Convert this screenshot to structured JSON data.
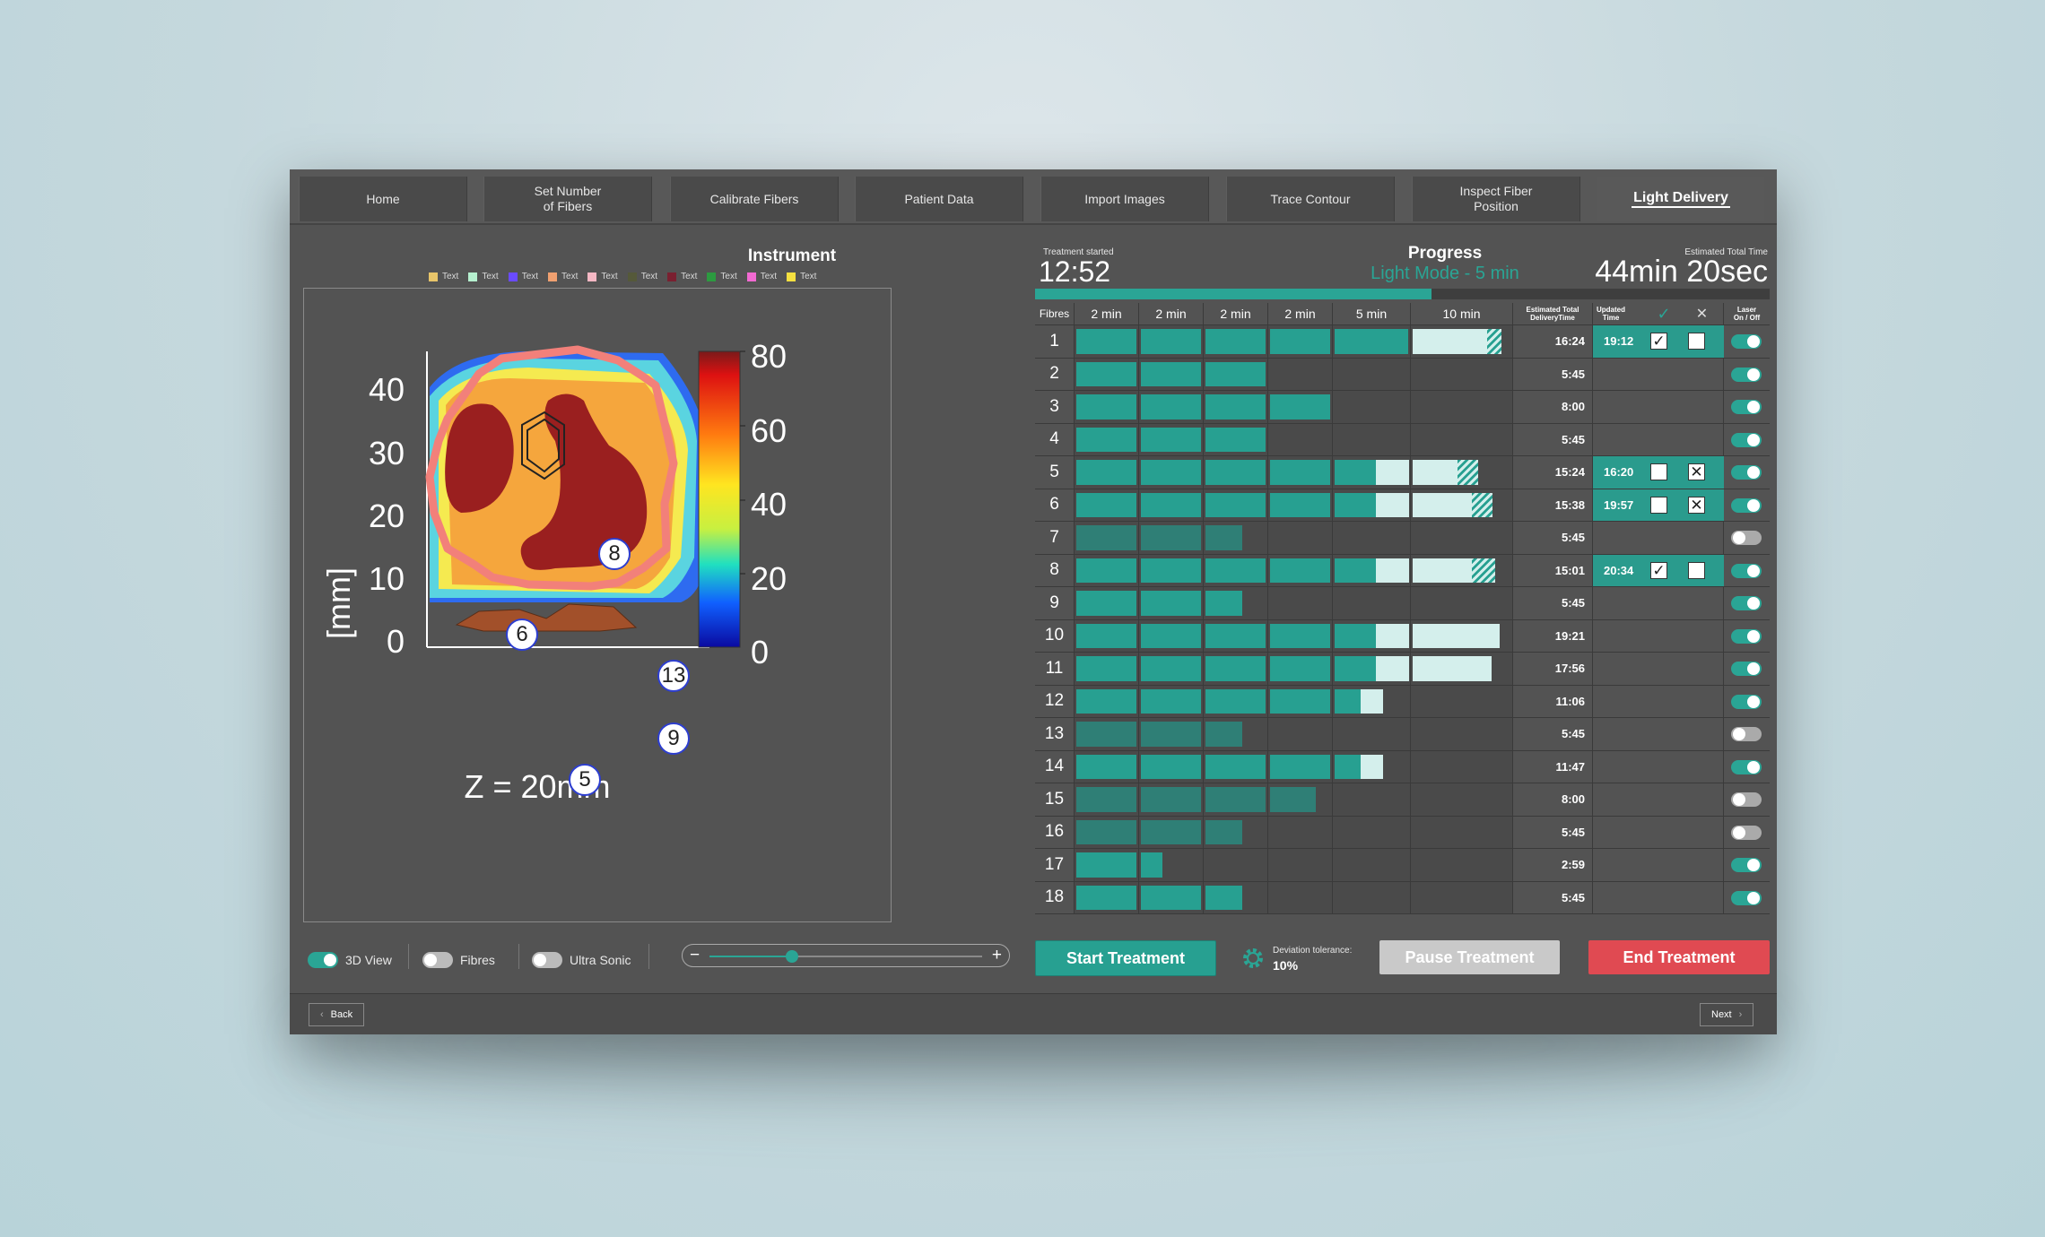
{
  "nav": {
    "tabs": [
      {
        "label": "Home"
      },
      {
        "label": "Set Number\nof Fibers"
      },
      {
        "label": "Calibrate Fibers"
      },
      {
        "label": "Patient Data"
      },
      {
        "label": "Import Images"
      },
      {
        "label": "Trace Contour"
      },
      {
        "label": "Inspect Fiber\nPosition"
      },
      {
        "label": "Light Delivery"
      }
    ],
    "active": "Light Delivery"
  },
  "instrument": {
    "title": "Instrument",
    "legend": [
      {
        "label": "Text",
        "color": "#e8c56a"
      },
      {
        "label": "Text",
        "color": "#b6f0cf"
      },
      {
        "label": "Text",
        "color": "#6a4bff"
      },
      {
        "label": "Text",
        "color": "#f0a070"
      },
      {
        "label": "Text",
        "color": "#f5b8c4"
      },
      {
        "label": "Text",
        "color": "#55593a"
      },
      {
        "label": "Text",
        "color": "#7a2030"
      },
      {
        "label": "Text",
        "color": "#2c9a40"
      },
      {
        "label": "Text",
        "color": "#f26ad2"
      },
      {
        "label": "Text",
        "color": "#f5e040"
      }
    ]
  },
  "plot": {
    "ylabel": "[mm]",
    "yticks": [
      "40",
      "30",
      "20",
      "10",
      "0"
    ],
    "colorbar_ticks": [
      "80",
      "60",
      "40",
      "20",
      "0"
    ],
    "caption": "Z = 20mm",
    "fibre_markers": [
      "6",
      "8",
      "13",
      "9",
      "5"
    ]
  },
  "controls": {
    "view3d": {
      "label": "3D View",
      "on": true
    },
    "fibres": {
      "label": "Fibres",
      "on": false
    },
    "ultrasonic": {
      "label": "Ultra Sonic",
      "on": false
    },
    "zoom": {
      "minus": "−",
      "plus": "+",
      "value": 0.3
    }
  },
  "status": {
    "started_label": "Treatment started",
    "started_time": "12:52",
    "progress_title": "Progress",
    "mode": "Light Mode - 5 min",
    "est_label": "Estimated Total Time",
    "est_value": "44min 20sec",
    "progress": 0.54
  },
  "table": {
    "headers": {
      "fibres": "Fibres",
      "steps": [
        "2 min",
        "2 min",
        "2 min",
        "2 min",
        "5 min",
        "10 min"
      ],
      "est": "Estimated Total\nDeliveryTime",
      "updated": "Updated\nTime",
      "check": "✓",
      "cross": "✕",
      "laser": "Laser\nOn / Off"
    },
    "rows": [
      {
        "n": "1",
        "est": "16:24",
        "upd": "19:12",
        "chk": "✓",
        "x": "",
        "laser": true
      },
      {
        "n": "2",
        "est": "5:45",
        "laser": true
      },
      {
        "n": "3",
        "est": "8:00",
        "laser": true
      },
      {
        "n": "4",
        "est": "5:45",
        "laser": true
      },
      {
        "n": "5",
        "est": "15:24",
        "upd": "16:20",
        "chk": "",
        "x": "✕",
        "laser": true
      },
      {
        "n": "6",
        "est": "15:38",
        "upd": "19:57",
        "chk": "",
        "x": "✕",
        "laser": true
      },
      {
        "n": "7",
        "est": "5:45",
        "laser": false
      },
      {
        "n": "8",
        "est": "15:01",
        "upd": "20:34",
        "chk": "✓",
        "x": "",
        "laser": true
      },
      {
        "n": "9",
        "est": "5:45",
        "laser": true
      },
      {
        "n": "10",
        "est": "19:21",
        "laser": true
      },
      {
        "n": "11",
        "est": "17:56",
        "laser": true
      },
      {
        "n": "12",
        "est": "11:06",
        "laser": true
      },
      {
        "n": "13",
        "est": "5:45",
        "laser": false
      },
      {
        "n": "14",
        "est": "11:47",
        "laser": true
      },
      {
        "n": "15",
        "est": "8:00",
        "laser": false
      },
      {
        "n": "16",
        "est": "5:45",
        "laser": false
      },
      {
        "n": "17",
        "est": "2:59",
        "laser": true
      },
      {
        "n": "18",
        "est": "5:45",
        "laser": true
      }
    ]
  },
  "actions": {
    "start": "Start Treatment",
    "deviation_label": "Deviation tolerance:",
    "deviation_value": "10%",
    "pause": "Pause Treatment",
    "end": "End Treatment",
    "back": "Back",
    "next": "Next"
  },
  "colors": {
    "accent": "#2aa595",
    "end": "#e04a52",
    "pause": "#c9c9c9"
  }
}
